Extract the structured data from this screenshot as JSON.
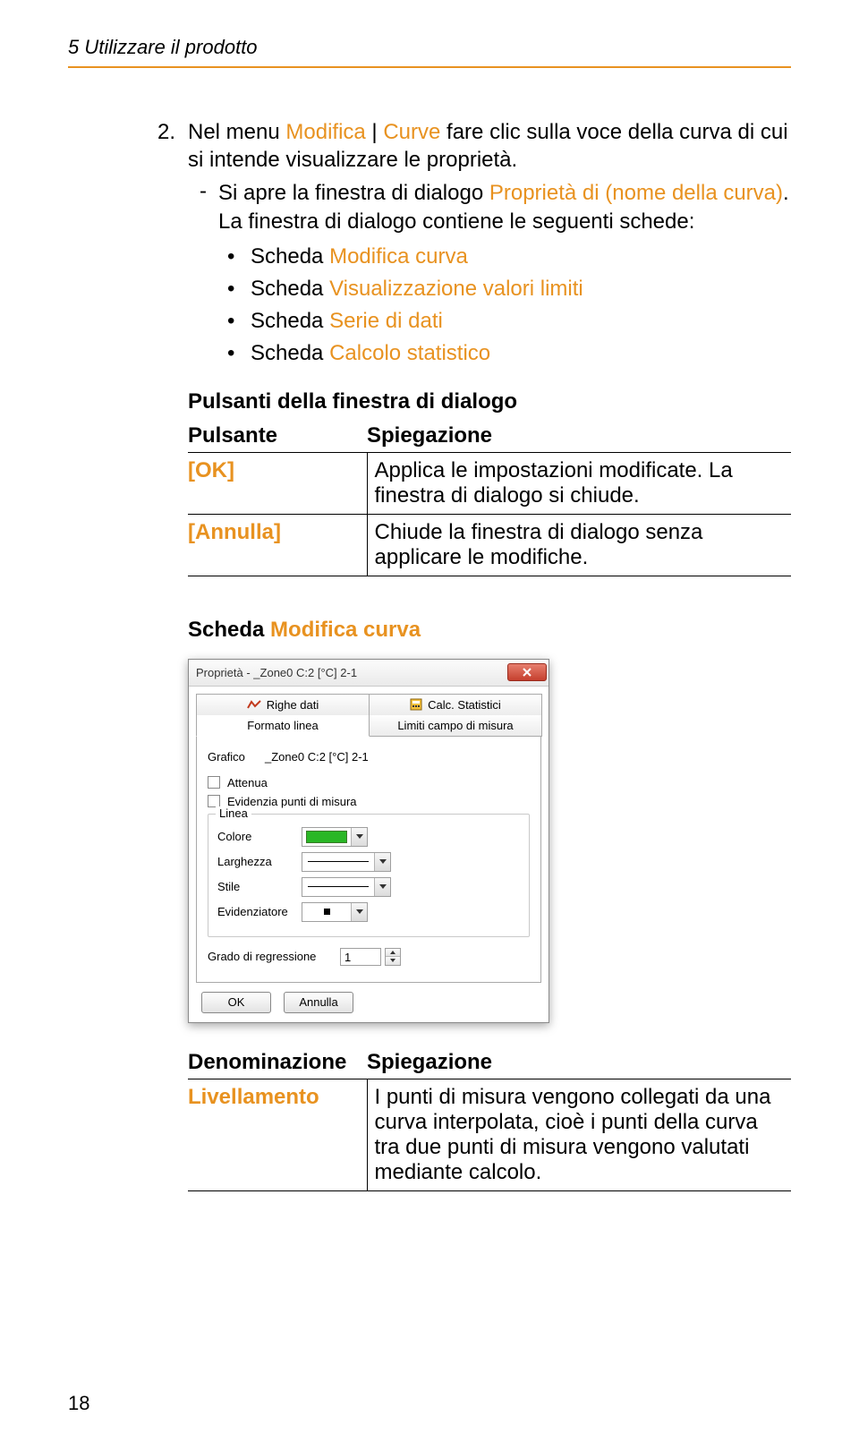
{
  "header": {
    "title": "5 Utilizzare il prodotto"
  },
  "intro": {
    "step_no": "2.",
    "step_line1": "Nel menu ",
    "step_term1": "Modifica",
    "step_sep": " | ",
    "step_term2": "Curve",
    "step_line2": " fare clic sulla voce della curva di cui si intende visualizzare le proprietà.",
    "dash": "-",
    "result_line1": "Si apre la finestra di dialogo ",
    "result_term": "Proprietà di (nome della curva)",
    "result_line2": ". La finestra di dialogo contiene le seguenti schede:"
  },
  "schede": [
    {
      "pre": "Scheda ",
      "term": "Modifica curva"
    },
    {
      "pre": "Scheda ",
      "term": "Visualizzazione valori limiti"
    },
    {
      "pre": "Scheda ",
      "term": "Serie di dati"
    },
    {
      "pre": "Scheda ",
      "term": "Calcolo statistico"
    }
  ],
  "table1": {
    "caption": "Pulsanti della finestra di dialogo",
    "head_left": "Pulsante",
    "head_right": "Spiegazione",
    "rows": [
      {
        "left": "[OK]",
        "right": "Applica le impostazioni modificate. La finestra di dialogo si chiude."
      },
      {
        "left": "[Annulla]",
        "right": "Chiude la finestra di dialogo senza applicare le modifiche."
      }
    ]
  },
  "section2": {
    "pre": "Scheda ",
    "term": "Modifica curva"
  },
  "dialog": {
    "title": "Proprietà - _Zone0 C:2 [°C] 2-1",
    "tabs": {
      "righe": "Righe dati",
      "calc": "Calc. Statistici",
      "formato": "Formato linea",
      "limiti": "Limiti campo di misura"
    },
    "grafico_label": "Grafico",
    "grafico_value": "_Zone0 C:2 [°C] 2-1",
    "attenua": "Attenua",
    "evidenzia_punti": "Evidenzia punti di misura",
    "group_label": "Linea",
    "colore_label": "Colore",
    "colore_value": "#2ab726",
    "larghezza_label": "Larghezza",
    "stile_label": "Stile",
    "evidenziatore_label": "Evidenziatore",
    "regressione_label": "Grado di regressione",
    "regressione_value": "1",
    "ok": "OK",
    "annulla": "Annulla"
  },
  "table2": {
    "head_left": "Denominazione",
    "head_right": "Spiegazione",
    "row_left": "Livellamento",
    "row_right": "I punti di misura vengono collegati da una curva interpolata, cioè i punti della curva tra due punti di misura vengono valutati mediante calcolo."
  },
  "pagenum": "18"
}
